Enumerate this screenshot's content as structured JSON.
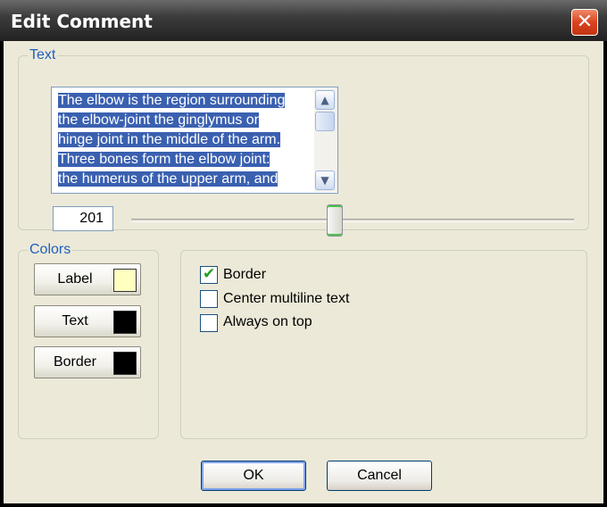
{
  "window": {
    "title": "Edit Comment",
    "close_glyph": "✕"
  },
  "text_group": {
    "legend": "Text",
    "lines": [
      "The elbow is the region surrounding",
      "the elbow-joint the ginglymus or",
      "hinge joint in the middle of the arm.",
      "Three bones form the elbow joint:",
      "the humerus of the upper arm, and"
    ],
    "selection_color": "#3a60b0",
    "scroll_up_icon": "▲",
    "scroll_down_icon": "▼"
  },
  "slider": {
    "value": "201",
    "position_fraction": 0.46
  },
  "colors_group": {
    "legend": "Colors",
    "buttons": [
      {
        "label": "Label",
        "color": "#ffffc0"
      },
      {
        "label": "Text",
        "color": "#000000"
      },
      {
        "label": "Border",
        "color": "#000000"
      }
    ]
  },
  "options": [
    {
      "label": "Border",
      "checked": true
    },
    {
      "label": "Center multiline text",
      "checked": false
    },
    {
      "label": "Always on top",
      "checked": false
    }
  ],
  "buttons": {
    "ok": "OK",
    "cancel": "Cancel"
  }
}
